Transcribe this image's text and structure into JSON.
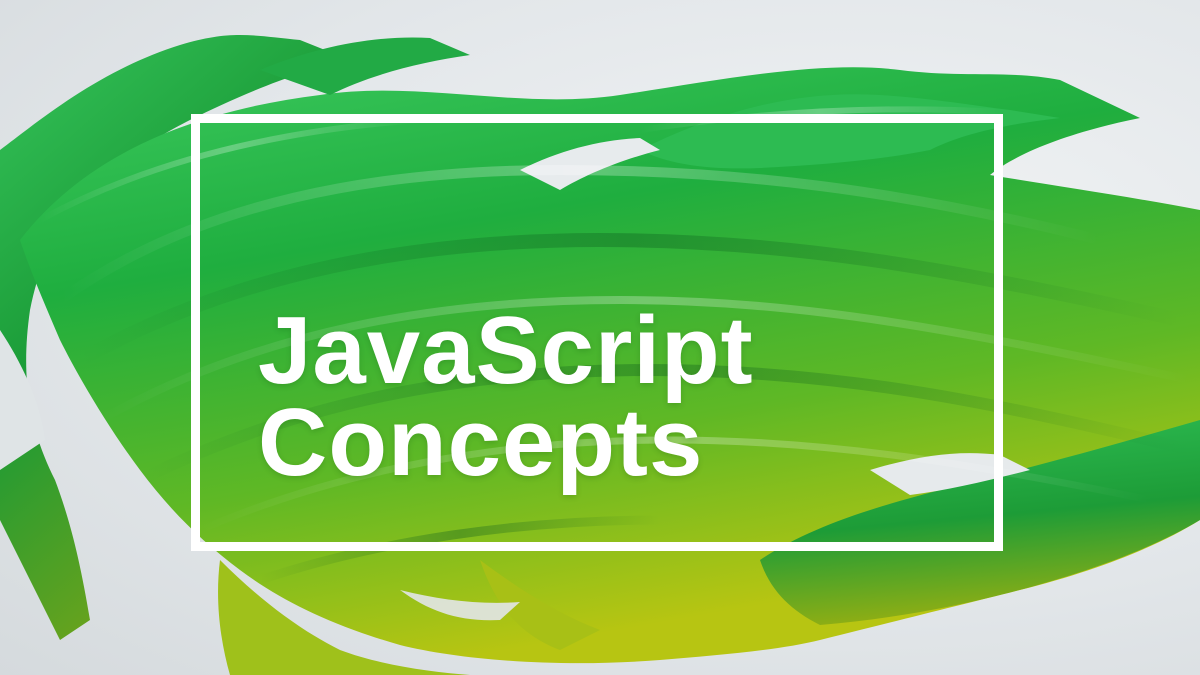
{
  "title": {
    "line1": "JavaScript",
    "line2": "Concepts"
  },
  "colors": {
    "background": "#e3e7ea",
    "stroke_green": "#22b14c",
    "stroke_yellow": "#b8c814",
    "frame": "#ffffff",
    "text": "#ffffff"
  }
}
